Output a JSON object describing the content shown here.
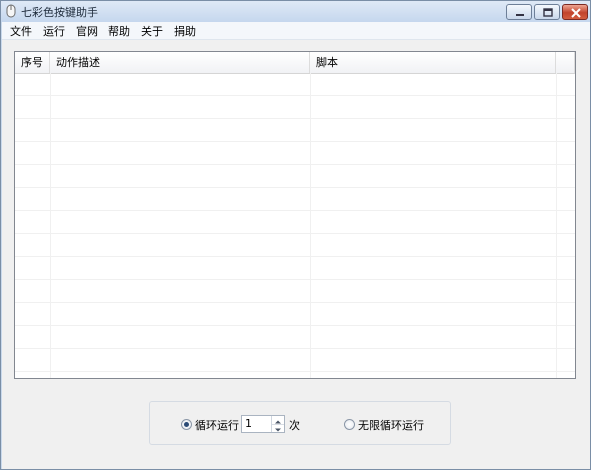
{
  "window": {
    "title": "七彩色按键助手"
  },
  "menu": [
    "文件",
    "运行",
    "官网",
    "帮助",
    "关于",
    "捐助"
  ],
  "table": {
    "columns": [
      "序号",
      "动作描述",
      "脚本",
      ""
    ],
    "rows": []
  },
  "run_options": {
    "loop_label": "循环运行",
    "loop_count": "1",
    "times_unit": "次",
    "infinite_label": "无限循环运行",
    "selected": "loop"
  },
  "icons": {
    "app": "mouse-icon",
    "minimize": "minimize-icon",
    "maximize": "maximize-icon",
    "close": "close-icon"
  }
}
